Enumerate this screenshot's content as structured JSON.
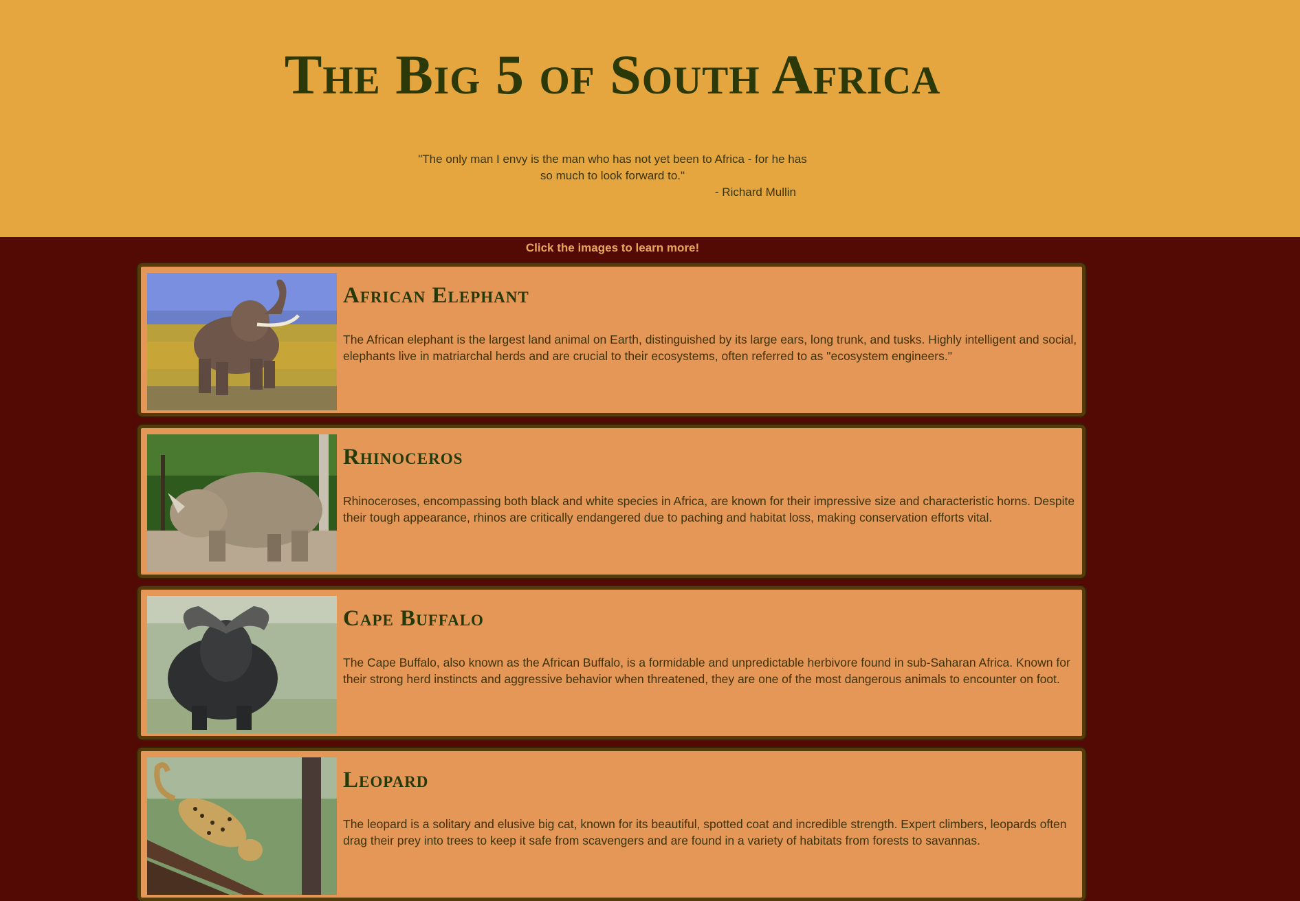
{
  "header": {
    "title": "The Big 5 of South Africa",
    "quote": "\"The only man I envy is the man who has not yet been to Africa - for he has so much to look forward to.\"",
    "attribution": "- Richard Mullin"
  },
  "hint": "Click the images to learn more!",
  "animals": [
    {
      "name": "African Elephant",
      "description": "The African elephant is the largest land animal on Earth, distinguished by its large ears, long trunk, and tusks. Highly intelligent and social, elephants live in matriarchal herds and are crucial to their ecosystems, often referred to as \"ecosystem engineers.\"",
      "image": "elephant-photo"
    },
    {
      "name": "Rhinoceros",
      "description": "Rhinoceroses, encompassing both black and white species in Africa, are known for their impressive size and characteristic horns. Despite their tough appearance, rhinos are critically endangered due to paching and habitat loss, making conservation efforts vital.",
      "image": "rhinoceros-photo"
    },
    {
      "name": "Cape Buffalo",
      "description": "The Cape Buffalo, also known as the African Buffalo, is a formidable and unpredictable herbivore found in sub-Saharan Africa. Known for their strong herd instincts and aggressive behavior when threatened, they are one of the most dangerous animals to encounter on foot.",
      "image": "cape-buffalo-photo"
    },
    {
      "name": "Leopard",
      "description": "The leopard is a solitary and elusive big cat, known for its beautiful, spotted coat and incredible strength. Expert climbers, leopards often drag their prey into trees to keep it safe from scavengers and are found in a variety of habitats from forests to savannas.",
      "image": "leopard-photo"
    }
  ],
  "colors": {
    "header_bg": "#e5a63f",
    "page_bg": "#530a05",
    "card_bg": "#e59757",
    "card_border": "#553b0a",
    "title_text": "#2b3807",
    "hint_text": "#e8a85a"
  }
}
